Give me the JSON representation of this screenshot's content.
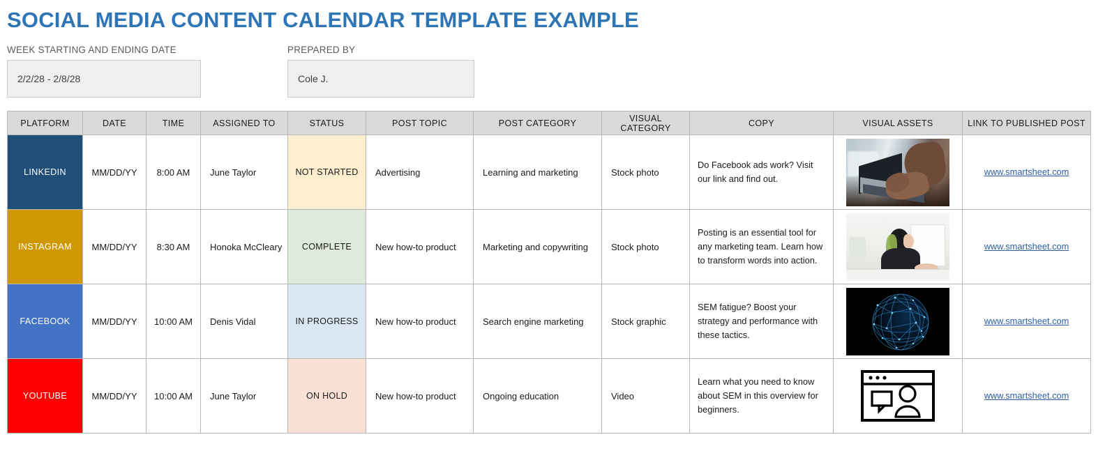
{
  "title": "SOCIAL MEDIA CONTENT CALENDAR TEMPLATE EXAMPLE",
  "colors": {
    "title_blue": "#2E75B6",
    "header_gray": "#D9D9D9",
    "linkedin": "#1F4E79",
    "instagram": "#D09800",
    "facebook": "#4472C4",
    "youtube": "#FF0000",
    "status_not_started": "#FDEFCD",
    "status_complete": "#DEEADA",
    "status_in_progress": "#DAE6F1",
    "status_on_hold": "#FBE1D5",
    "link_blue": "#2E5FA3"
  },
  "meta": {
    "week_label": "WEEK STARTING AND ENDING DATE",
    "week_value": "2/2/28 - 2/8/28",
    "prepared_label": "PREPARED BY",
    "prepared_value": "Cole J."
  },
  "table": {
    "headers": [
      "PLATFORM",
      "DATE",
      "TIME",
      "ASSIGNED TO",
      "STATUS",
      "POST TOPIC",
      "POST CATEGORY",
      "VISUAL CATEGORY",
      "COPY",
      "VISUAL ASSETS",
      "LINK TO PUBLISHED POST"
    ],
    "rows": [
      {
        "platform": "LINKEDIN",
        "platform_color": "#1F4E79",
        "date": "MM/DD/YY",
        "time": "8:00 AM",
        "assigned_to": "June Taylor",
        "status": "NOT STARTED",
        "status_color": "#FDEFCD",
        "post_topic": "Advertising",
        "post_category": "Learning and marketing",
        "visual_category": "Stock photo",
        "copy": "Do Facebook ads work? Visit our link and find out.",
        "visual_asset": "photo-laptop-hands-typing",
        "link": "www.smartsheet.com"
      },
      {
        "platform": "INSTAGRAM",
        "platform_color": "#D09800",
        "date": "MM/DD/YY",
        "time": "8:30 AM",
        "assigned_to": "Honoka McCleary",
        "status": "COMPLETE",
        "status_color": "#DEEADA",
        "post_topic": "New how-to product",
        "post_category": "Marketing and copywriting",
        "visual_category": "Stock photo",
        "copy": "Posting is an essential tool for any marketing team. Learn how to transform words into action.",
        "visual_asset": "photo-woman-at-computer",
        "link": "www.smartsheet.com"
      },
      {
        "platform": "FACEBOOK",
        "platform_color": "#4472C4",
        "date": "MM/DD/YY",
        "time": "10:00 AM",
        "assigned_to": "Denis Vidal",
        "status": "IN PROGRESS",
        "status_color": "#DAE6F1",
        "post_topic": "New how-to product",
        "post_category": "Search engine marketing",
        "visual_category": "Stock graphic",
        "copy": "SEM fatigue? Boost your strategy and performance with these tactics.",
        "visual_asset": "graphic-blue-wireframe-globe",
        "link": "www.smartsheet.com"
      },
      {
        "platform": "YOUTUBE",
        "platform_color": "#FF0000",
        "date": "MM/DD/YY",
        "time": "10:00 AM",
        "assigned_to": "June Taylor",
        "status": "ON HOLD",
        "status_color": "#FBE1D5",
        "post_topic": "New how-to product",
        "post_category": "Ongoing education",
        "visual_category": "Video",
        "copy": "Learn what you need to know about SEM in this overview for beginners.",
        "visual_asset": "icon-webinar-browser-chat-person",
        "link": "www.smartsheet.com"
      }
    ]
  }
}
